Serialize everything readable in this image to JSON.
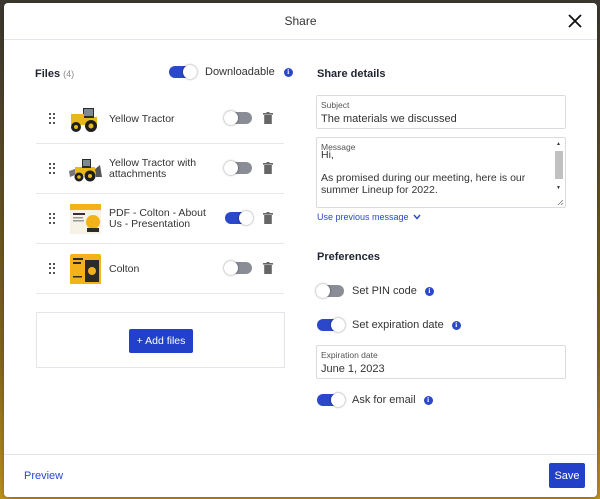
{
  "header": {
    "title": "Share"
  },
  "files": {
    "heading": "Files",
    "count": "(4)",
    "downloadable_label": "Downloadable",
    "downloadable_on": true,
    "items": [
      {
        "name": "Yellow Tractor",
        "thumb": "tractor",
        "enabled": false
      },
      {
        "name": "Yellow Tractor with attachments",
        "thumb": "tractor-attachments",
        "enabled": false
      },
      {
        "name": "PDF - Colton - About Us - Presentation",
        "thumb": "pdf-presentation",
        "enabled": true
      },
      {
        "name": "Colton",
        "thumb": "colton-brochure",
        "enabled": false
      }
    ],
    "add_files_label": "+ Add files"
  },
  "share_details": {
    "heading": "Share details",
    "subject_label": "Subject",
    "subject_value": "The materials we discussed",
    "message_label": "Message",
    "message_value": "Hi,\n\nAs promised during our meeting, here is our summer Lineup for 2022.",
    "use_previous_label": "Use previous message"
  },
  "preferences": {
    "heading": "Preferences",
    "pin_label": "Set PIN code",
    "pin_on": false,
    "expiration_label": "Set expiration date",
    "expiration_on": true,
    "expiration_date_label": "Expiration date",
    "expiration_date_value": "June 1, 2023",
    "ask_email_label": "Ask for email",
    "ask_email_on": true
  },
  "footer": {
    "preview_label": "Preview",
    "save_label": "Save"
  },
  "colors": {
    "accent": "#2340c8",
    "toggle_off": "#8a8d96",
    "border": "#e3e5ea"
  },
  "icons": {
    "close": "close-icon",
    "info": "info-icon",
    "trash": "trash-icon",
    "drag": "drag-handle-icon",
    "chevron": "chevron-down-icon"
  }
}
